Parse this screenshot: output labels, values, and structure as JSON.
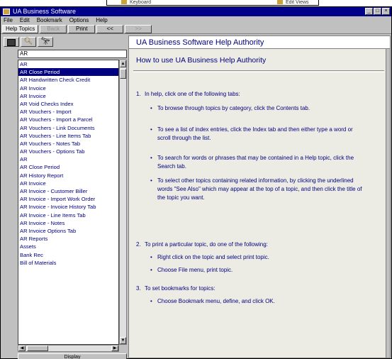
{
  "background": {
    "item1": "Keyboard",
    "item2": "Edit Views"
  },
  "window": {
    "title": "UA Business Software",
    "controls": [
      "_",
      "□",
      "×"
    ]
  },
  "menu": [
    "File",
    "Edit",
    "Bookmark",
    "Options",
    "Help"
  ],
  "toolbar": {
    "buttons": [
      {
        "label": "Help Topics",
        "enabled": true
      },
      {
        "label": "Back",
        "enabled": false
      },
      {
        "label": "Print",
        "enabled": true
      },
      {
        "label": "<<",
        "enabled": true
      },
      {
        "label": ">>",
        "enabled": false
      }
    ]
  },
  "left_pane": {
    "search_value": "AR",
    "topics": [
      "AR",
      "AR Close Period",
      "AR Handwritten Check Credit",
      "AR Invoice",
      "AR Invoice",
      "AR Void Checks Index",
      "AR Vouchers - Import",
      "AR Vouchers - Import a Parcel",
      "AR Vouchers - Link Documents",
      "AR Vouchers - Line Items Tab",
      "AR Vouchers - Notes Tab",
      "AR Vouchers - Options Tab",
      "AR",
      "AR Close Period",
      "AR History Report",
      "AR Invoice",
      "AR Invoice - Customer Biller",
      "AR Invoice - Import Work Order",
      "AR Invoice - Invoice History Tab",
      "AR Invoice - Line Items Tab",
      "AR Invoice - Notes",
      "AR Invoice Options Tab",
      "AR Reports",
      "Assets",
      "Bank Rec",
      "Bill of Materials"
    ],
    "selected_index": 1,
    "display_button": "Display"
  },
  "right_pane": {
    "header": "UA Business Software Help Authority",
    "heading": "How to use UA Business Help Authority",
    "steps": [
      {
        "num": "1.",
        "text": "In help, click one of the following tabs:",
        "bullets": [
          "To browse through topics by category, click the Contents tab.",
          "To see a list of index entries, click the Index tab and then either type a word or scroll through the list.",
          "To search for words or phrases that may be contained in a Help topic, click the Search tab.",
          "To select other topics containing related information, by clicking the underlined words \"See Also\" which may appear at the top of a topic, and then click the title of the topic you want."
        ]
      },
      {
        "num": "2.",
        "text": "To print a particular topic, do one of the following:",
        "bullets": [
          "Right click on the topic and select print topic.",
          "Choose File menu, print topic."
        ]
      },
      {
        "num": "3.",
        "text": "To set bookmarks for topics:",
        "bullets": [
          "Choose Bookmark menu, define, and click OK."
        ]
      }
    ]
  }
}
